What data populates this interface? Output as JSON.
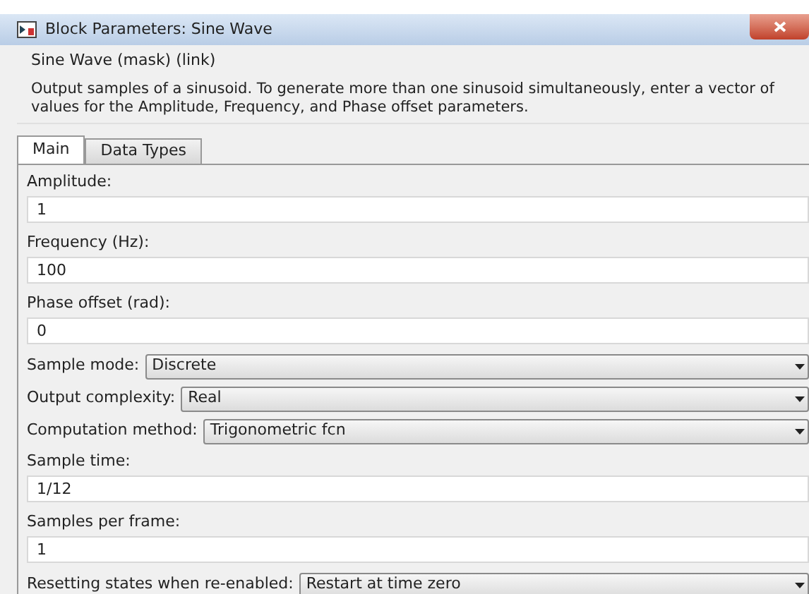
{
  "window": {
    "title": "Block Parameters: Sine Wave"
  },
  "block_type": "Sine Wave (mask) (link)",
  "description": "Output samples of a sinusoid.  To generate more than one sinusoid simultaneously, enter a vector of values for the Amplitude, Frequency, and Phase offset parameters.",
  "tabs": [
    {
      "label": "Main",
      "selected": true
    },
    {
      "label": "Data Types",
      "selected": false
    }
  ],
  "parameters": [
    {
      "kind": "text",
      "label": "Amplitude:",
      "value": "1"
    },
    {
      "kind": "text",
      "label": "Frequency (Hz):",
      "value": "100"
    },
    {
      "kind": "text",
      "label": "Phase offset (rad):",
      "value": "0"
    },
    {
      "kind": "dropdown",
      "label": "Sample mode:",
      "value": "Discrete"
    },
    {
      "kind": "dropdown",
      "label": "Output complexity:",
      "value": "Real"
    },
    {
      "kind": "dropdown",
      "label": "Computation method:",
      "value": "Trigonometric fcn"
    },
    {
      "kind": "text",
      "label": "Sample time:",
      "value": "1/12"
    },
    {
      "kind": "text",
      "label": "Samples per frame:",
      "value": "1"
    },
    {
      "kind": "dropdown",
      "label": "Resetting states when re-enabled:",
      "value": "Restart at time zero"
    }
  ]
}
